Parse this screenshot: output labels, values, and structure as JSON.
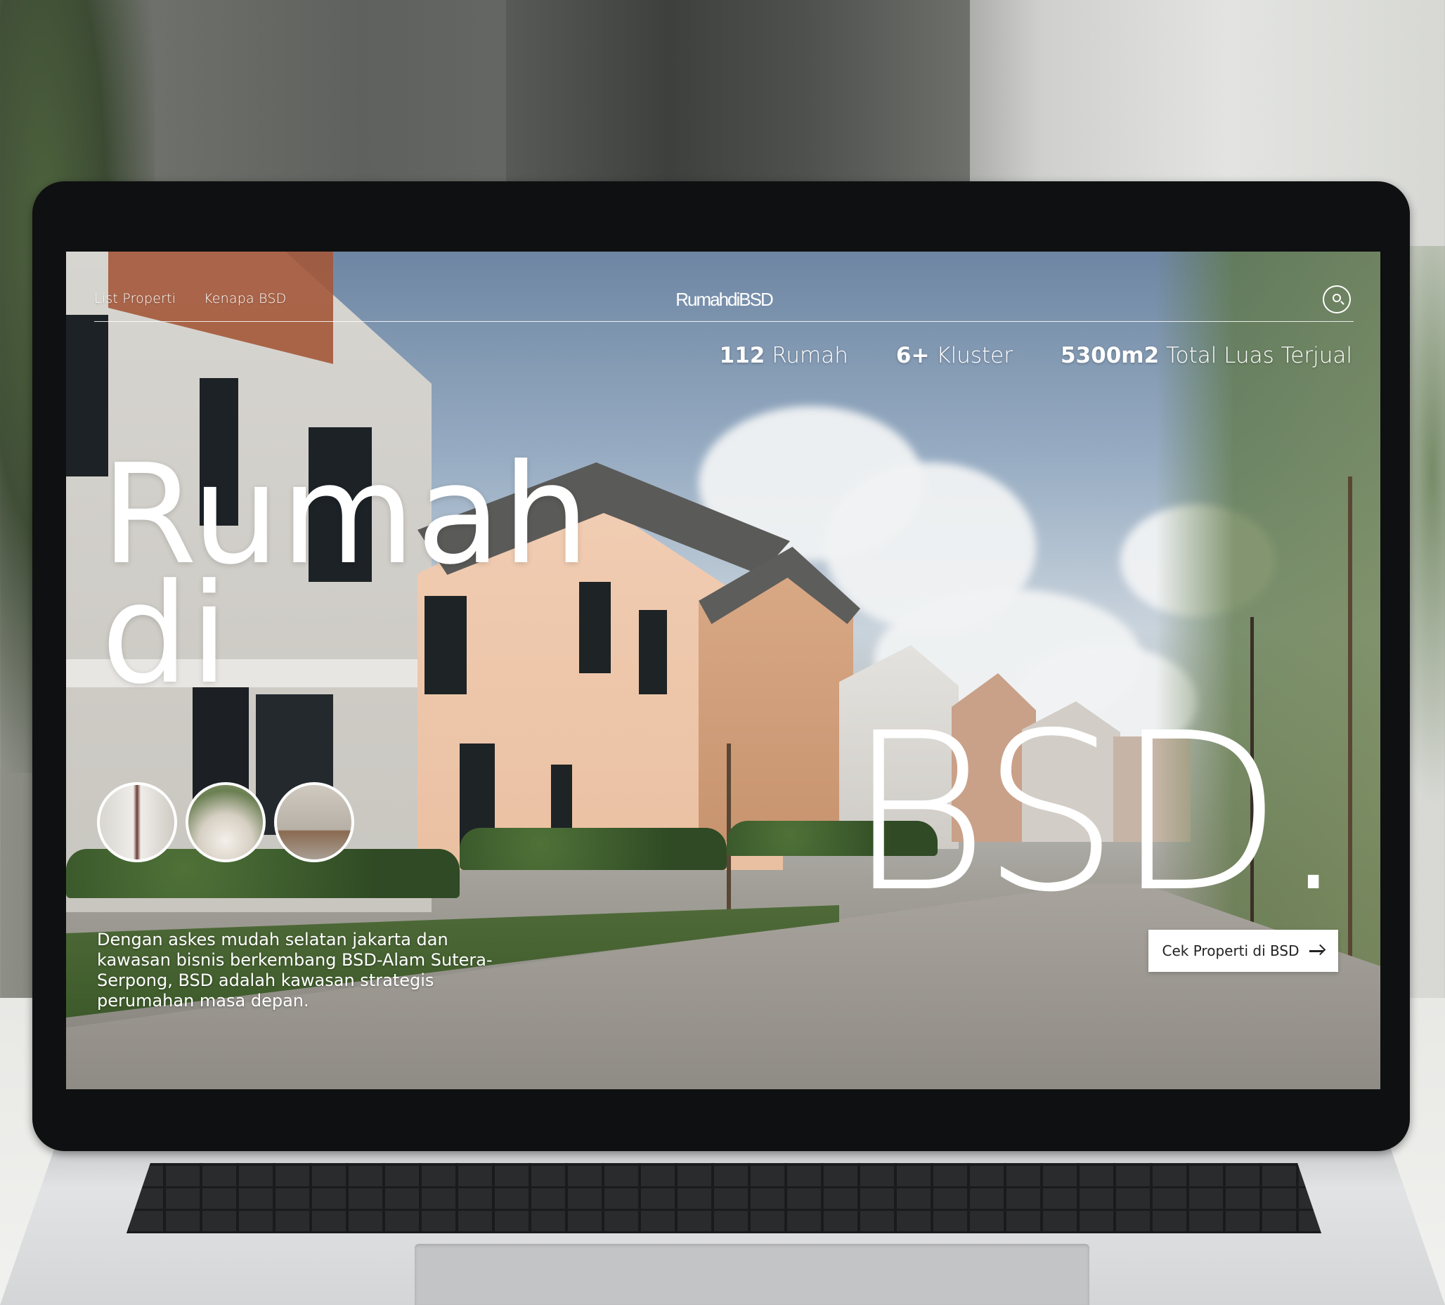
{
  "nav": {
    "links": [
      "List Properti",
      "Kenapa BSD"
    ],
    "brand": "RumahdiBSD",
    "search_icon": "search-icon"
  },
  "stats": [
    {
      "value": "112",
      "label": "Rumah"
    },
    {
      "value": "6+",
      "label": "Kluster"
    },
    {
      "value": "5300m2",
      "label": "Total Luas Terjual"
    }
  ],
  "hero": {
    "line1": "Rumah",
    "line2": "di",
    "line3": "BSD."
  },
  "thumbnails": [
    "hallway-photo",
    "garden-woman-photo",
    "interior-chair-photo"
  ],
  "description": "Dengan askes mudah selatan jakarta dan kawasan bisnis berkembang BSD-Alam Sutera-Serpong, BSD adalah kawasan strategis perumahan masa depan.",
  "cta": {
    "label": "Cek Properti di BSD",
    "icon": "arrow-right-icon"
  },
  "colors": {
    "text": "#ffffff",
    "cta_bg": "#ffffff",
    "cta_text": "#222222"
  }
}
